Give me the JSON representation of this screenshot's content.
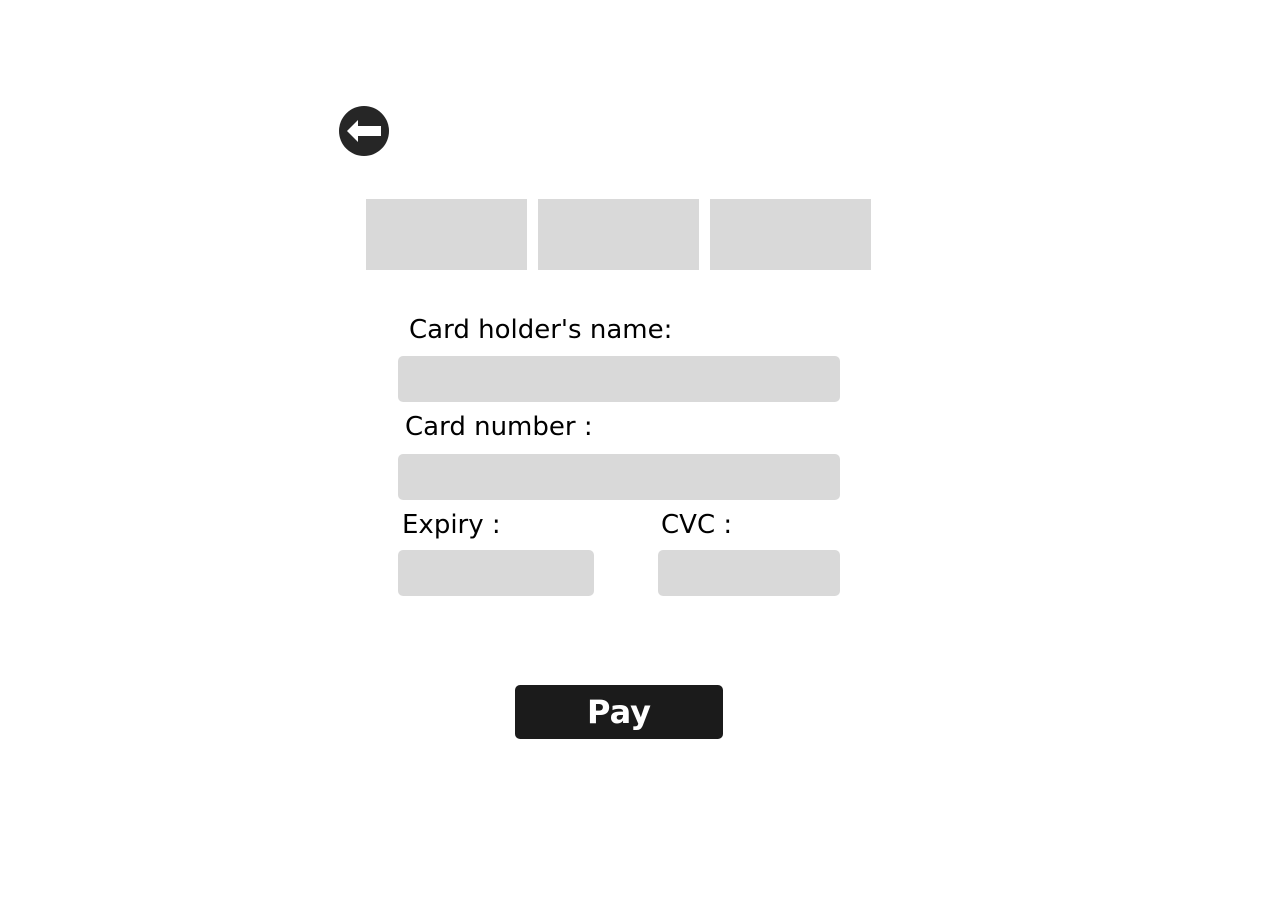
{
  "header": {
    "back_icon": "arrow-left-circle-icon"
  },
  "card_options": [
    {
      "label": ""
    },
    {
      "label": ""
    },
    {
      "label": ""
    }
  ],
  "form": {
    "name_label": "Card holder's name:",
    "name_value": "",
    "number_label": "Card number :",
    "number_value": "",
    "expiry_label": "Expiry :",
    "expiry_value": "",
    "cvc_label": "CVC :",
    "cvc_value": ""
  },
  "actions": {
    "pay_label": "Pay"
  },
  "colors": {
    "background": "#ffffff",
    "placeholder_gray": "#d9d9d9",
    "button_dark": "#1b1b1b",
    "icon_dark": "#262626",
    "text": "#000000"
  }
}
